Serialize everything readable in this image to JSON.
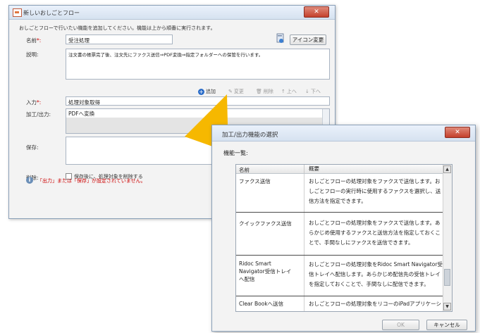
{
  "win1": {
    "title": "新しいおしごとフロー",
    "close": "✕",
    "instruction": "おしごとフローで行いたい機能を追加してください。機能は上から順番に実行されます。",
    "name_label": "名前",
    "name_req": "*:",
    "name_value": "受注処理",
    "icon_button": "アイコン変更",
    "desc_label": "説明:",
    "desc_value": "注文書の帳票完了後、注文先にファクス送信⇒PDF変換⇒指定フォルダーへの保管を行います。",
    "toolbar": {
      "add": "追加",
      "edit": "変更",
      "delete": "削除",
      "up": "上へ",
      "down": "下へ"
    },
    "input_label": "入力",
    "input_req": "*:",
    "input_value": "処理対象取得",
    "process_label": "加工/出力:",
    "process_value": "PDFへ変換",
    "save_label": "保存:",
    "delete_label": "削除:",
    "delete_checkbox": "保存後に、処理対象を削除する",
    "warning": "「出力」または「保存」が設定されていません。"
  },
  "win2": {
    "title": "加工/出力機能の選択",
    "close": "✕",
    "list_label": "機能一覧:",
    "columns": {
      "name": "名前",
      "desc": "概要"
    },
    "rows": [
      {
        "name": "ファクス送信",
        "desc": "おしごとフローの処理対象をファクスで送信します。おしごとフローの実行時に使用するファクスを選択し、送信方法を指定できます。"
      },
      {
        "name": "クイックファクス送信",
        "desc": "おしごとフローの処理対象をファクスで送信します。あらかじめ使用するファクスと送信方法を指定しておくことで、手間なしにファクスを送信できます。"
      },
      {
        "name": "Ridoc Smart Navigator受信トレイへ配信",
        "desc": "おしごとフローの処理対象をRidoc Smart Navigator受信トレイへ配信します。あらかじめ配信先の受信トレイを指定しておくことで、手間なしに配信できます。"
      },
      {
        "name": "Clear Bookへ送信",
        "desc": "おしごとフローの処理対象をリコーのiPadアプリケーションである"
      }
    ],
    "ok": "OK",
    "cancel": "キャンセル"
  },
  "colors": {
    "accent_arrow": "#f6b800",
    "warning": "#cc0000",
    "close": "#c4402c"
  }
}
